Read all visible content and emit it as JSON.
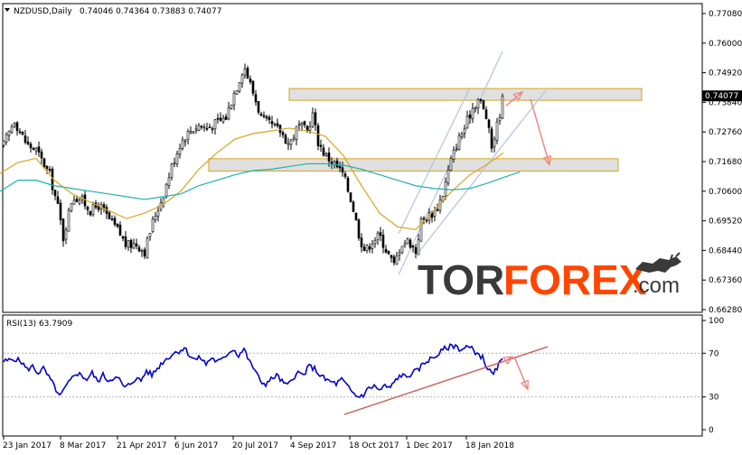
{
  "main_header": {
    "symbol_text": "NZDUSD,Daily",
    "ohlc_text": "0.74046 0.74364 0.73883 0.74077"
  },
  "rsi_header": {
    "text": "RSI(13) 63.7909"
  },
  "logo": {
    "part1": "TOR",
    "part2": "FOREX",
    "part3": ".com"
  },
  "colors": {
    "candle": "#000000",
    "ma_fast": "#DAA520",
    "ma_slow": "#20B2AA",
    "rsi_line": "#0000CD",
    "channel": "#B0C4DE",
    "zone_border": "#DAA520",
    "zone_fill": "#D3D3D3",
    "arrow": "#F08080",
    "trendline": "#CD5C5C",
    "logo_dark": "#3a3a3a",
    "logo_red": "#ff4500"
  },
  "chart_data": [
    {
      "type": "candlestick",
      "symbol": "NZDUSD",
      "timeframe": "Daily",
      "ylim": [
        0.6628,
        0.7708
      ],
      "yticks": [
        "0.77080",
        "0.76000",
        "0.74920",
        "0.73840",
        "0.72760",
        "0.71680",
        "0.70600",
        "0.69520",
        "0.68440",
        "0.67360",
        "0.66280"
      ],
      "current_price_label": "0.74077",
      "x_labels": [
        "23 Jan 2017",
        "8 Mar 2017",
        "21 Apr 2017",
        "6 Jun 2017",
        "20 Jul 2017",
        "4 Sep 2017",
        "18 Oct 2017",
        "1 Dec 2017",
        "18 Jan 2018"
      ],
      "close_path": [
        [
          0,
          0.72
        ],
        [
          8,
          0.726
        ],
        [
          16,
          0.732
        ],
        [
          20,
          0.729
        ],
        [
          30,
          0.723
        ],
        [
          40,
          0.721
        ],
        [
          55,
          0.712
        ],
        [
          65,
          0.699
        ],
        [
          70,
          0.689
        ],
        [
          80,
          0.704
        ],
        [
          90,
          0.703
        ],
        [
          100,
          0.699
        ],
        [
          110,
          0.701
        ],
        [
          120,
          0.696
        ],
        [
          130,
          0.692
        ],
        [
          140,
          0.686
        ],
        [
          150,
          0.687
        ],
        [
          160,
          0.684
        ],
        [
          170,
          0.696
        ],
        [
          180,
          0.704
        ],
        [
          190,
          0.715
        ],
        [
          200,
          0.724
        ],
        [
          210,
          0.728
        ],
        [
          220,
          0.73
        ],
        [
          230,
          0.729
        ],
        [
          240,
          0.731
        ],
        [
          250,
          0.733
        ],
        [
          258,
          0.741
        ],
        [
          264,
          0.746
        ],
        [
          270,
          0.752
        ],
        [
          276,
          0.746
        ],
        [
          284,
          0.738
        ],
        [
          290,
          0.732
        ],
        [
          300,
          0.73
        ],
        [
          310,
          0.728
        ],
        [
          320,
          0.723
        ],
        [
          330,
          0.73
        ],
        [
          340,
          0.728
        ],
        [
          346,
          0.734
        ],
        [
          352,
          0.724
        ],
        [
          360,
          0.719
        ],
        [
          370,
          0.716
        ],
        [
          380,
          0.712
        ],
        [
          390,
          0.701
        ],
        [
          398,
          0.689
        ],
        [
          404,
          0.684
        ],
        [
          412,
          0.688
        ],
        [
          420,
          0.69
        ],
        [
          428,
          0.684
        ],
        [
          436,
          0.679
        ],
        [
          444,
          0.687
        ],
        [
          452,
          0.688
        ],
        [
          460,
          0.684
        ],
        [
          466,
          0.695
        ],
        [
          474,
          0.697
        ],
        [
          482,
          0.699
        ],
        [
          490,
          0.705
        ],
        [
          498,
          0.716
        ],
        [
          506,
          0.724
        ],
        [
          514,
          0.729
        ],
        [
          522,
          0.736
        ],
        [
          530,
          0.74
        ],
        [
          538,
          0.733
        ],
        [
          544,
          0.722
        ],
        [
          550,
          0.73
        ],
        [
          557,
          0.7408
        ]
      ],
      "ma_fast": [
        [
          0,
          0.7125
        ],
        [
          20,
          0.7165
        ],
        [
          40,
          0.718
        ],
        [
          60,
          0.71
        ],
        [
          80,
          0.705
        ],
        [
          100,
          0.702
        ],
        [
          120,
          0.699
        ],
        [
          140,
          0.696
        ],
        [
          160,
          0.698
        ],
        [
          180,
          0.701
        ],
        [
          200,
          0.706
        ],
        [
          220,
          0.714
        ],
        [
          240,
          0.72
        ],
        [
          260,
          0.725
        ],
        [
          280,
          0.727
        ],
        [
          300,
          0.728
        ],
        [
          320,
          0.729
        ],
        [
          340,
          0.728
        ],
        [
          360,
          0.726
        ],
        [
          380,
          0.719
        ],
        [
          400,
          0.708
        ],
        [
          420,
          0.698
        ],
        [
          440,
          0.693
        ],
        [
          460,
          0.692
        ],
        [
          480,
          0.699
        ],
        [
          500,
          0.706
        ],
        [
          520,
          0.712
        ],
        [
          540,
          0.716
        ],
        [
          557,
          0.72
        ]
      ],
      "ma_slow": [
        [
          0,
          0.706
        ],
        [
          20,
          0.71
        ],
        [
          40,
          0.71
        ],
        [
          60,
          0.708
        ],
        [
          80,
          0.707
        ],
        [
          100,
          0.706
        ],
        [
          120,
          0.705
        ],
        [
          140,
          0.704
        ],
        [
          160,
          0.703
        ],
        [
          180,
          0.704
        ],
        [
          200,
          0.705
        ],
        [
          220,
          0.708
        ],
        [
          240,
          0.71
        ],
        [
          260,
          0.712
        ],
        [
          280,
          0.7135
        ],
        [
          300,
          0.714
        ],
        [
          320,
          0.715
        ],
        [
          340,
          0.716
        ],
        [
          360,
          0.716
        ],
        [
          380,
          0.7155
        ],
        [
          400,
          0.714
        ],
        [
          420,
          0.712
        ],
        [
          440,
          0.71
        ],
        [
          460,
          0.708
        ],
        [
          480,
          0.707
        ],
        [
          500,
          0.7065
        ],
        [
          520,
          0.707
        ],
        [
          540,
          0.709
        ],
        [
          557,
          0.711
        ],
        [
          575,
          0.713
        ]
      ],
      "zones": [
        {
          "x1": 320,
          "x2": 710,
          "y_low": 0.7408,
          "y_high": 0.7418
        },
        {
          "x1": 231,
          "x2": 684,
          "y_low": 0.715,
          "y_high": 0.7162
        }
      ],
      "channel_lines": [
        [
          [
            441,
            0.6755
          ],
          [
            556,
            0.757
          ]
        ],
        [
          [
            461,
            0.6828
          ],
          [
            604,
            0.7428
          ]
        ],
        [
          [
            441,
            0.6905
          ],
          [
            520,
            0.7437
          ]
        ]
      ],
      "arrows": [
        [
          [
            560,
            0.7372
          ],
          [
            578,
            0.7422
          ]
        ],
        [
          [
            587,
            0.7396
          ],
          [
            608,
            0.7156
          ]
        ]
      ]
    },
    {
      "type": "line",
      "name": "RSI(13)",
      "current_value": 63.7909,
      "ylim": [
        0,
        100
      ],
      "yticks": [
        100,
        70,
        30,
        0
      ],
      "levels": [
        70,
        30
      ],
      "values_path": [
        [
          0,
          62
        ],
        [
          8,
          63
        ],
        [
          16,
          65
        ],
        [
          24,
          62
        ],
        [
          30,
          55
        ],
        [
          36,
          58
        ],
        [
          42,
          52
        ],
        [
          48,
          56
        ],
        [
          54,
          48
        ],
        [
          60,
          40
        ],
        [
          66,
          30
        ],
        [
          72,
          38
        ],
        [
          78,
          45
        ],
        [
          84,
          52
        ],
        [
          90,
          50
        ],
        [
          96,
          46
        ],
        [
          102,
          52
        ],
        [
          108,
          44
        ],
        [
          114,
          50
        ],
        [
          120,
          45
        ],
        [
          126,
          48
        ],
        [
          132,
          46
        ],
        [
          138,
          38
        ],
        [
          144,
          42
        ],
        [
          150,
          47
        ],
        [
          156,
          45
        ],
        [
          162,
          54
        ],
        [
          168,
          50
        ],
        [
          174,
          56
        ],
        [
          180,
          62
        ],
        [
          186,
          66
        ],
        [
          192,
          70
        ],
        [
          198,
          72
        ],
        [
          204,
          75
        ],
        [
          210,
          68
        ],
        [
          216,
          64
        ],
        [
          222,
          66
        ],
        [
          228,
          60
        ],
        [
          234,
          66
        ],
        [
          240,
          62
        ],
        [
          246,
          64
        ],
        [
          252,
          70
        ],
        [
          258,
          74
        ],
        [
          264,
          68
        ],
        [
          270,
          74
        ],
        [
          276,
          62
        ],
        [
          282,
          55
        ],
        [
          288,
          44
        ],
        [
          294,
          42
        ],
        [
          300,
          46
        ],
        [
          306,
          50
        ],
        [
          312,
          44
        ],
        [
          318,
          40
        ],
        [
          324,
          48
        ],
        [
          330,
          52
        ],
        [
          336,
          50
        ],
        [
          342,
          58
        ],
        [
          348,
          56
        ],
        [
          354,
          50
        ],
        [
          360,
          46
        ],
        [
          366,
          44
        ],
        [
          372,
          42
        ],
        [
          378,
          46
        ],
        [
          384,
          40
        ],
        [
          390,
          34
        ],
        [
          396,
          30
        ],
        [
          402,
          32
        ],
        [
          408,
          38
        ],
        [
          414,
          40
        ],
        [
          420,
          36
        ],
        [
          426,
          40
        ],
        [
          432,
          38
        ],
        [
          438,
          46
        ],
        [
          444,
          50
        ],
        [
          450,
          48
        ],
        [
          456,
          52
        ],
        [
          462,
          54
        ],
        [
          468,
          60
        ],
        [
          474,
          64
        ],
        [
          480,
          66
        ],
        [
          486,
          70
        ],
        [
          492,
          74
        ],
        [
          498,
          76
        ],
        [
          504,
          77
        ],
        [
          510,
          73
        ],
        [
          516,
          76
        ],
        [
          522,
          74
        ],
        [
          528,
          70
        ],
        [
          534,
          66
        ],
        [
          540,
          55
        ],
        [
          546,
          50
        ],
        [
          552,
          60
        ],
        [
          557,
          64
        ]
      ],
      "trendline": [
        [
          381,
          14
        ],
        [
          606,
          76
        ]
      ],
      "arrows": [
        [
          [
            557,
            62
          ],
          [
            567,
            67
          ]
        ],
        [
          [
            569,
            67
          ],
          [
            584,
            37
          ]
        ]
      ]
    }
  ]
}
